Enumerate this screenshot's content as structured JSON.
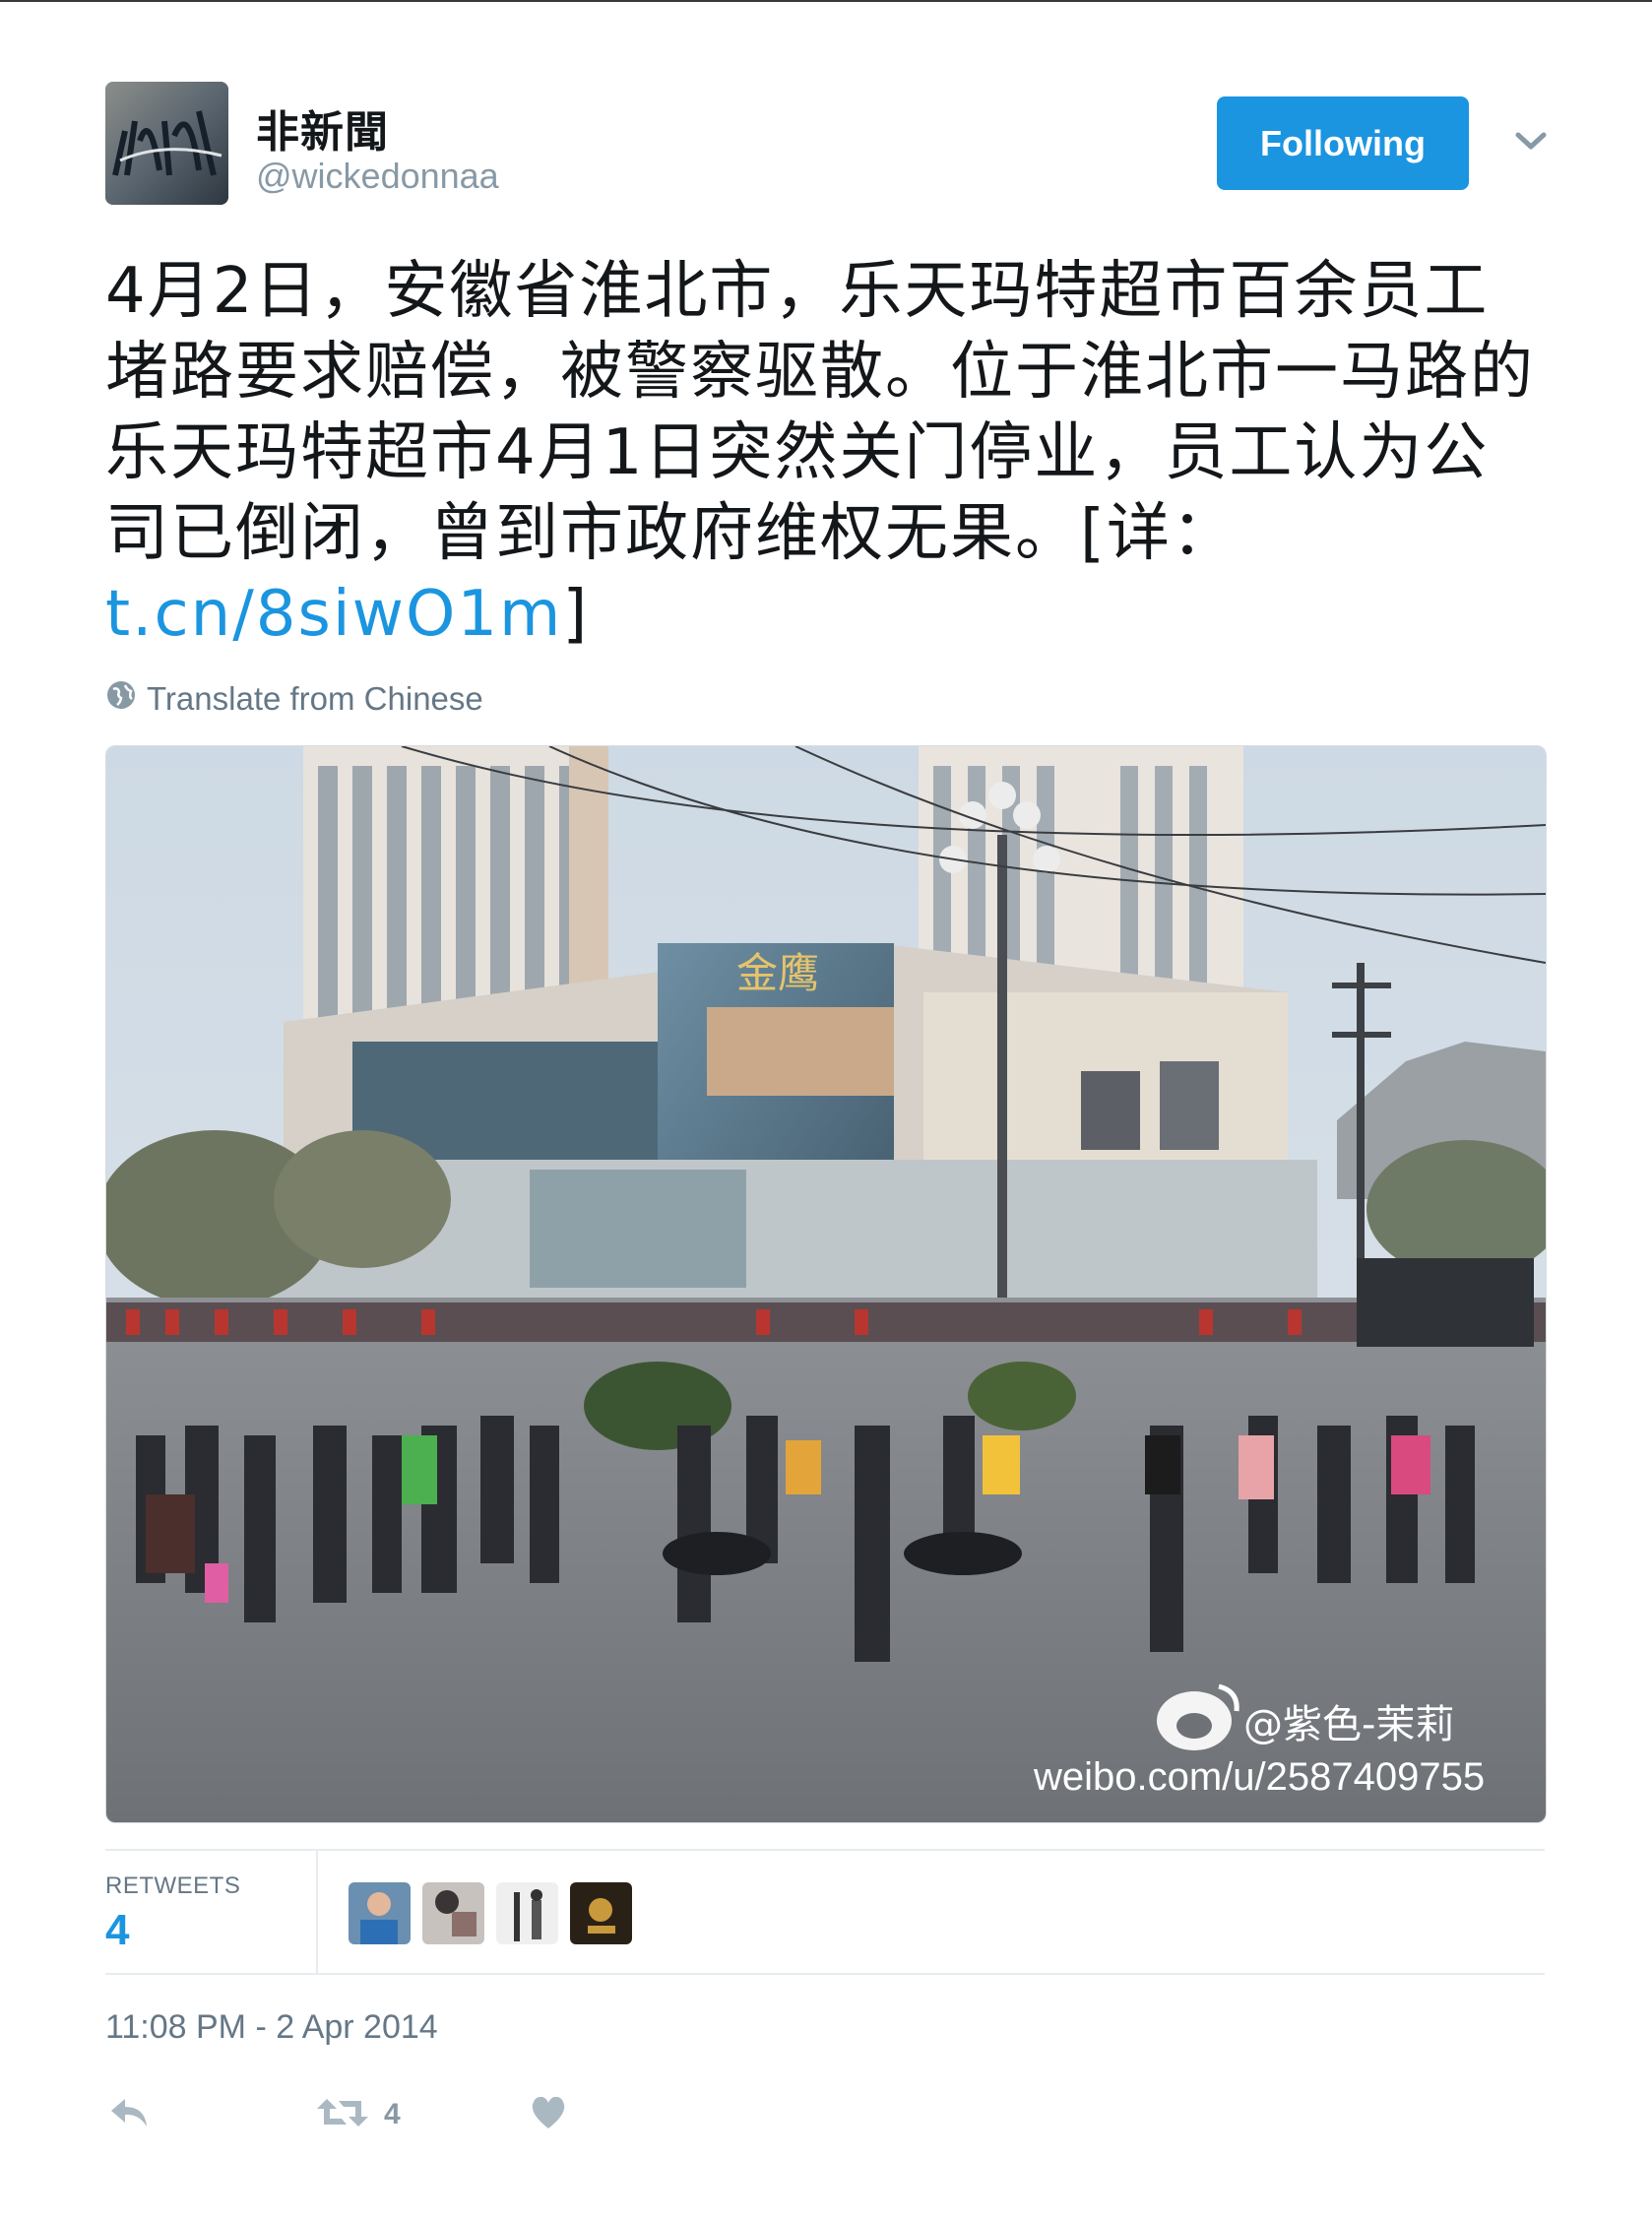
{
  "user": {
    "display_name": "非新聞",
    "handle": "@wickedonnaa"
  },
  "follow_button": {
    "label": "Following"
  },
  "tweet": {
    "text_before_link": "4月2日，安徽省淮北市，乐天玛特超市百余员工堵路要求赔偿，被警察驱散。位于淮北市一马路的乐天玛特超市4月1日突然关门停业，员工认为公司已倒闭，曾到市政府维权无果。[详：",
    "link": "t.cn/8siwO1m",
    "text_after_link": "]"
  },
  "translate": {
    "label": "Translate from Chinese"
  },
  "photo": {
    "watermark_user": "@紫色-茉莉",
    "watermark_url": "weibo.com/u/2587409755",
    "sign_text": "金鹰"
  },
  "stats": {
    "retweets_label": "RETWEETS",
    "retweets_value": "4"
  },
  "timestamp": "11:08 PM - 2 Apr 2014",
  "actions": {
    "retweet_count": "4"
  },
  "colors": {
    "accent": "#1b95e0",
    "text": "#14171a",
    "muted": "#657786"
  },
  "icons": [
    "avatar-image",
    "chevron-down-icon",
    "globe-icon",
    "reply-icon",
    "retweet-icon",
    "heart-icon",
    "weibo-logo-icon"
  ]
}
